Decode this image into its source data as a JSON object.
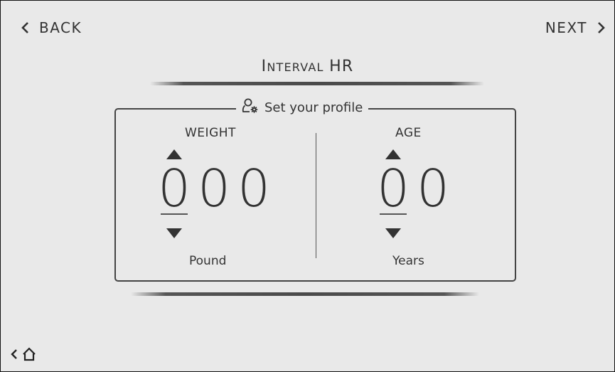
{
  "nav": {
    "back_label": "BACK",
    "next_label": "NEXT"
  },
  "title": {
    "first_initial": "I",
    "first_rest": "NTERVAL",
    "second": "HR"
  },
  "profile": {
    "heading": "Set your profile",
    "heading_icon": "user-gear-icon"
  },
  "weight": {
    "label": "WEIGHT",
    "digits": [
      "0",
      "0",
      "0"
    ],
    "unit": "Pound"
  },
  "age": {
    "label": "AGE",
    "digits": [
      "0",
      "0"
    ],
    "unit": "Years"
  },
  "icons": {
    "back": "chevron-left-icon",
    "next": "chevron-right-icon",
    "up": "triangle-up-icon",
    "down": "triangle-down-icon",
    "home": "home-icon"
  },
  "colors": {
    "background": "#e9e9e9",
    "foreground": "#333333",
    "border": "#444444"
  }
}
